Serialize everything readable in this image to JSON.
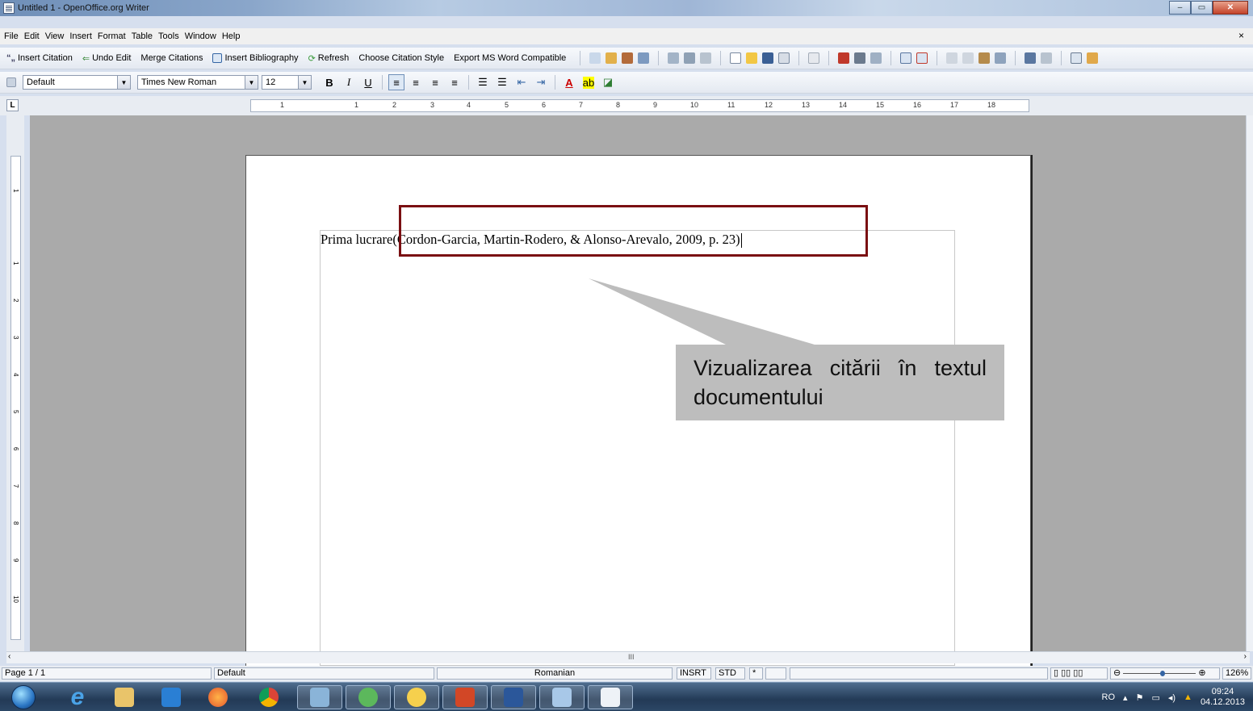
{
  "window": {
    "title": "Untitled 1 - OpenOffice.org Writer",
    "minimize_glyph": "–",
    "maximize_glyph": "▭",
    "close_glyph": "✕"
  },
  "menu": {
    "items": [
      "File",
      "Edit",
      "View",
      "Insert",
      "Format",
      "Table",
      "Tools",
      "Window",
      "Help"
    ],
    "close_doc_glyph": "×"
  },
  "citation_toolbar": {
    "insert_citation": "Insert Citation",
    "undo_edit": "Undo Edit",
    "merge_citations": "Merge Citations",
    "insert_bibliography": "Insert Bibliography",
    "refresh": "Refresh",
    "choose_citation_style": "Choose Citation Style",
    "export_ms_word": "Export MS Word Compatible"
  },
  "format_toolbar": {
    "paragraph_style": "Default",
    "font_name": "Times New Roman",
    "font_size": "12",
    "bold": "B",
    "italic": "I",
    "underline": "U"
  },
  "ruler": {
    "corner": "L",
    "h_ticks": [
      "1",
      "1",
      "2",
      "3",
      "4",
      "5",
      "6",
      "7",
      "8",
      "9",
      "10",
      "11",
      "12",
      "13",
      "14",
      "15",
      "16",
      "17",
      "18"
    ],
    "v_ticks": [
      "1",
      "1",
      "2",
      "3",
      "4",
      "5",
      "6",
      "7",
      "8",
      "9",
      "10"
    ]
  },
  "document": {
    "text_before": "Prima lucrare",
    "citation": "(Cordon-Garcia, Martin-Rodero, & Alonso-Arevalo, 2009, p. 23)"
  },
  "annotation": {
    "callout_text": "Vizualizarea citării în textul documentului",
    "highlight_color": "#7a0f12",
    "callout_color": "#bdbdbd"
  },
  "statusbar": {
    "page": "Page 1 / 1",
    "page_style": "Default",
    "language": "Romanian",
    "insert_mode": "INSRT",
    "selection_mode": "STD",
    "modified": "*",
    "zoom": "126%"
  },
  "taskbar": {
    "apps": [
      "internet-explorer",
      "file-explorer",
      "media-player",
      "firefox",
      "chrome",
      "network",
      "green-app",
      "messenger",
      "powerpoint",
      "word",
      "paint",
      "openoffice-writer"
    ],
    "language": "RO",
    "time": "09:24",
    "date": "04.12.2013"
  }
}
